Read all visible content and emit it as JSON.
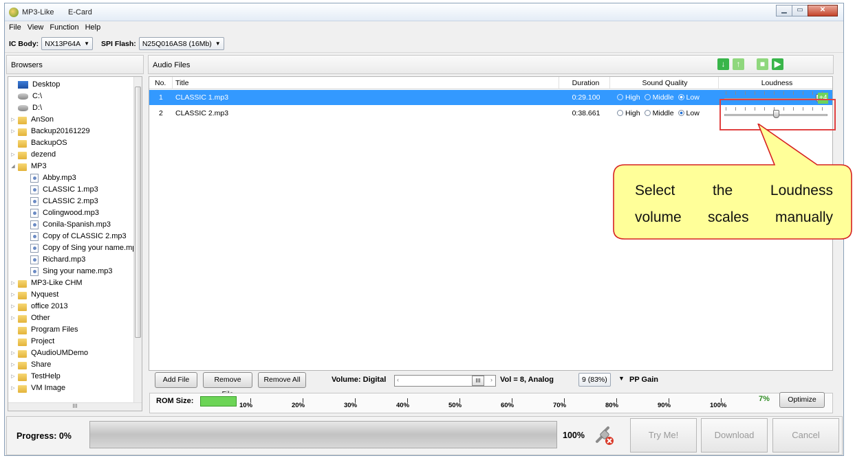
{
  "window": {
    "app_title": "MP3-Like",
    "subtitle": "E-Card"
  },
  "menu": [
    "File",
    "View",
    "Function",
    "Help"
  ],
  "toolbar": {
    "ic_label": "IC Body:",
    "ic_value": "NX13P64A",
    "spi_label": "SPI Flash:",
    "spi_value": "N25Q016AS8 (16Mb)"
  },
  "browser": {
    "title": "Browsers",
    "items": [
      {
        "label": "Desktop",
        "type": "desktop",
        "indent": 0,
        "exp": ""
      },
      {
        "label": "C:\\",
        "type": "drive",
        "indent": 0,
        "exp": ""
      },
      {
        "label": "D:\\",
        "type": "drive",
        "indent": 0,
        "exp": ""
      },
      {
        "label": "AnSon",
        "type": "folder",
        "indent": 0,
        "exp": "▷"
      },
      {
        "label": "Backup20161229",
        "type": "folder",
        "indent": 0,
        "exp": "▷"
      },
      {
        "label": "BackupOS",
        "type": "folder",
        "indent": 0,
        "exp": ""
      },
      {
        "label": "dezend",
        "type": "folder",
        "indent": 0,
        "exp": "▷"
      },
      {
        "label": "MP3",
        "type": "folder",
        "indent": 0,
        "exp": "◢"
      },
      {
        "label": "Abby.mp3",
        "type": "mp3",
        "indent": 1,
        "exp": ""
      },
      {
        "label": "CLASSIC 1.mp3",
        "type": "mp3",
        "indent": 1,
        "exp": ""
      },
      {
        "label": "CLASSIC 2.mp3",
        "type": "mp3",
        "indent": 1,
        "exp": ""
      },
      {
        "label": "Colingwood.mp3",
        "type": "mp3",
        "indent": 1,
        "exp": ""
      },
      {
        "label": "Conila-Spanish.mp3",
        "type": "mp3",
        "indent": 1,
        "exp": ""
      },
      {
        "label": "Copy of CLASSIC 2.mp3",
        "type": "mp3",
        "indent": 1,
        "exp": ""
      },
      {
        "label": "Copy of Sing your name.mp",
        "type": "mp3",
        "indent": 1,
        "exp": ""
      },
      {
        "label": "Richard.mp3",
        "type": "mp3",
        "indent": 1,
        "exp": ""
      },
      {
        "label": "Sing your name.mp3",
        "type": "mp3",
        "indent": 1,
        "exp": ""
      },
      {
        "label": "MP3-Like CHM",
        "type": "folder",
        "indent": 0,
        "exp": "▷"
      },
      {
        "label": "Nyquest",
        "type": "folder",
        "indent": 0,
        "exp": "▷"
      },
      {
        "label": "office 2013",
        "type": "folder",
        "indent": 0,
        "exp": "▷"
      },
      {
        "label": "Other",
        "type": "folder",
        "indent": 0,
        "exp": "▷"
      },
      {
        "label": "Program Files",
        "type": "folder",
        "indent": 0,
        "exp": ""
      },
      {
        "label": "Project",
        "type": "folder",
        "indent": 0,
        "exp": ""
      },
      {
        "label": "QAudioUMDemo",
        "type": "folder",
        "indent": 0,
        "exp": "▷"
      },
      {
        "label": "Share",
        "type": "folder",
        "indent": 0,
        "exp": "▷"
      },
      {
        "label": "TestHelp",
        "type": "folder",
        "indent": 0,
        "exp": "▷"
      },
      {
        "label": "VM Image",
        "type": "folder",
        "indent": 0,
        "exp": "▷"
      }
    ],
    "hscroll_mid": "III"
  },
  "audio": {
    "title": "Audio Files",
    "columns": {
      "no": "No.",
      "title": "Title",
      "duration": "Duration",
      "quality": "Sound Quality",
      "loudness": "Loudness"
    },
    "quality_options": [
      "High",
      "Middle",
      "Low"
    ],
    "rows": [
      {
        "no": "1",
        "title": "CLASSIC 1.mp3",
        "duration": "0:29.100",
        "quality": "Low",
        "loudness_level": 0.94,
        "loudness_label": "+4"
      },
      {
        "no": "2",
        "title": "CLASSIC 2.mp3",
        "duration": "0:38.661",
        "quality": "Low",
        "loudness_level": 0.5
      }
    ]
  },
  "controls": {
    "add_file": "Add File",
    "remove_file": "Remove File",
    "remove_all": "Remove All",
    "volume_label": "Volume:  Digital",
    "volume_thumb": "III",
    "vol_text": "Vol = 8,  Analog",
    "analog_value": "9 (83%)",
    "pp_gain": "PP Gain",
    "rom_label": "ROM Size:",
    "rom_percent": "7%",
    "rom_fill": 0.07,
    "optimize": "Optimize",
    "rom_ticks": [
      "10%",
      "20%",
      "30%",
      "40%",
      "50%",
      "60%",
      "70%",
      "80%",
      "90%",
      "100%"
    ]
  },
  "progress": {
    "label": "Progress:  0%",
    "value": 0,
    "right_text": "100%"
  },
  "actions": {
    "try_me": "Try Me!",
    "download": "Download",
    "cancel": "Cancel"
  },
  "callout": {
    "line1": "Select  the  Loudness",
    "line2": "volume scales manually"
  },
  "colors": {
    "selection": "#3399ff",
    "highlight": "#e04040",
    "callout_fill": "#ffff99",
    "green": "#6cd456"
  }
}
